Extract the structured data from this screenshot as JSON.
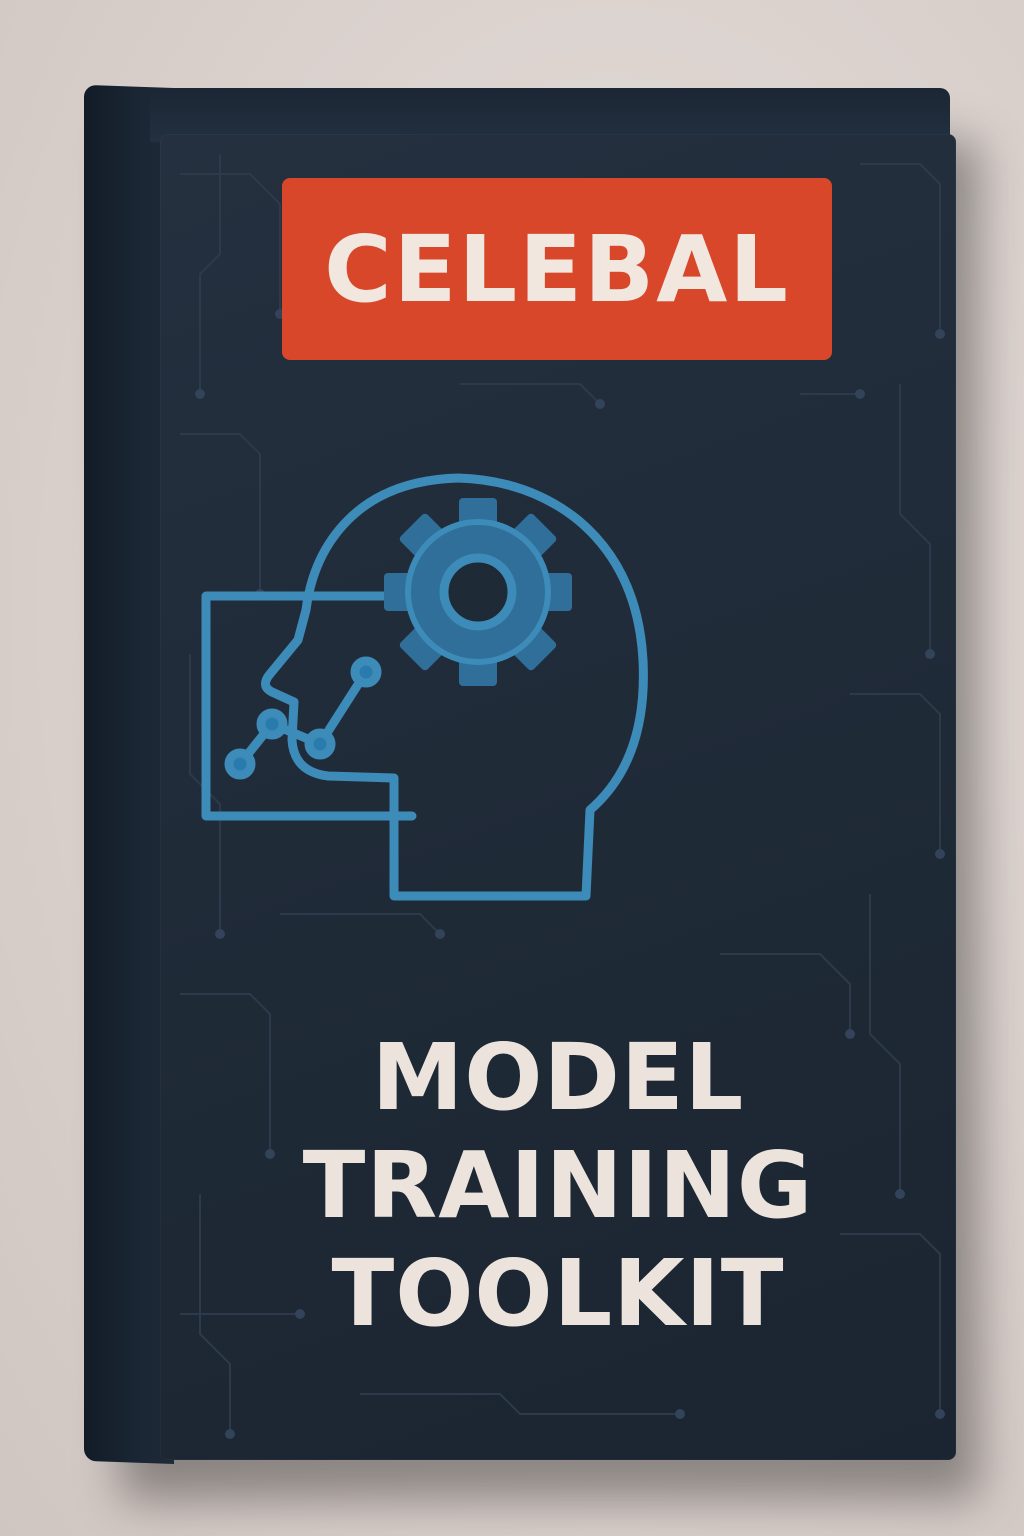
{
  "box": {
    "brand": "CELEBAL",
    "title_lines": [
      "MODEL",
      "TRAINING",
      "TOOLKIT"
    ]
  },
  "icons": {
    "emblem": "head-with-gear-icon",
    "chart": "line-chart-icon"
  },
  "colors": {
    "box": "#1f2a37",
    "badge": "#d8472a",
    "title_text": "#ece4dc",
    "icon_stroke": "#3d8bb8",
    "wall": "#ddd5d1"
  }
}
